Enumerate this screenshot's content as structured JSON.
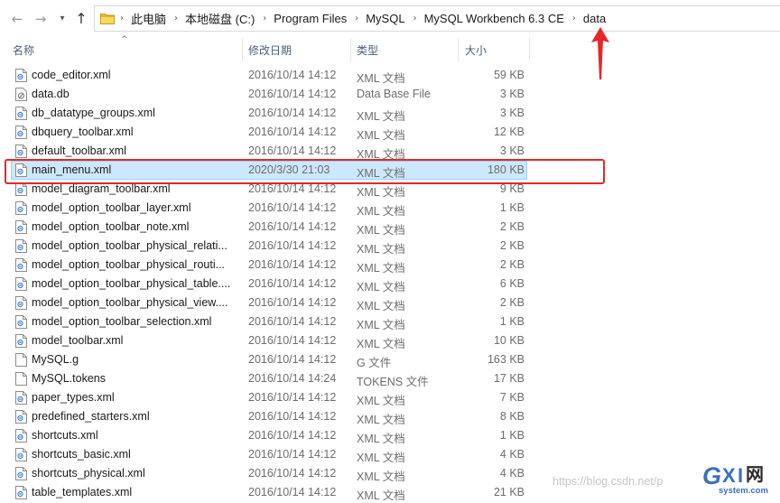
{
  "address_bar": {
    "crumbs": [
      "此电脑",
      "本地磁盘 (C:)",
      "Program Files",
      "MySQL",
      "MySQL Workbench 6.3 CE",
      "data"
    ]
  },
  "columns": {
    "name": "名称",
    "date": "修改日期",
    "type": "类型",
    "size": "大小"
  },
  "files": [
    {
      "name": "code_editor.xml",
      "date": "2016/10/14 14:12",
      "type": "XML 文档",
      "size": "59 KB",
      "icon": "xml"
    },
    {
      "name": "data.db",
      "date": "2016/10/14 14:12",
      "type": "Data Base File",
      "size": "3 KB",
      "icon": "db"
    },
    {
      "name": "db_datatype_groups.xml",
      "date": "2016/10/14 14:12",
      "type": "XML 文档",
      "size": "3 KB",
      "icon": "xml"
    },
    {
      "name": "dbquery_toolbar.xml",
      "date": "2016/10/14 14:12",
      "type": "XML 文档",
      "size": "12 KB",
      "icon": "xml"
    },
    {
      "name": "default_toolbar.xml",
      "date": "2016/10/14 14:12",
      "type": "XML 文档",
      "size": "3 KB",
      "icon": "xml"
    },
    {
      "name": "main_menu.xml",
      "date": "2020/3/30 21:03",
      "type": "XML 文档",
      "size": "180 KB",
      "icon": "xml",
      "selected": true
    },
    {
      "name": "model_diagram_toolbar.xml",
      "date": "2016/10/14 14:12",
      "type": "XML 文档",
      "size": "9 KB",
      "icon": "xml"
    },
    {
      "name": "model_option_toolbar_layer.xml",
      "date": "2016/10/14 14:12",
      "type": "XML 文档",
      "size": "1 KB",
      "icon": "xml"
    },
    {
      "name": "model_option_toolbar_note.xml",
      "date": "2016/10/14 14:12",
      "type": "XML 文档",
      "size": "2 KB",
      "icon": "xml"
    },
    {
      "name": "model_option_toolbar_physical_relati...",
      "date": "2016/10/14 14:12",
      "type": "XML 文档",
      "size": "2 KB",
      "icon": "xml"
    },
    {
      "name": "model_option_toolbar_physical_routi...",
      "date": "2016/10/14 14:12",
      "type": "XML 文档",
      "size": "2 KB",
      "icon": "xml"
    },
    {
      "name": "model_option_toolbar_physical_table....",
      "date": "2016/10/14 14:12",
      "type": "XML 文档",
      "size": "6 KB",
      "icon": "xml"
    },
    {
      "name": "model_option_toolbar_physical_view....",
      "date": "2016/10/14 14:12",
      "type": "XML 文档",
      "size": "2 KB",
      "icon": "xml"
    },
    {
      "name": "model_option_toolbar_selection.xml",
      "date": "2016/10/14 14:12",
      "type": "XML 文档",
      "size": "1 KB",
      "icon": "xml"
    },
    {
      "name": "model_toolbar.xml",
      "date": "2016/10/14 14:12",
      "type": "XML 文档",
      "size": "10 KB",
      "icon": "xml"
    },
    {
      "name": "MySQL.g",
      "date": "2016/10/14 14:12",
      "type": "G 文件",
      "size": "163 KB",
      "icon": "blank"
    },
    {
      "name": "MySQL.tokens",
      "date": "2016/10/14 14:24",
      "type": "TOKENS 文件",
      "size": "17 KB",
      "icon": "blank"
    },
    {
      "name": "paper_types.xml",
      "date": "2016/10/14 14:12",
      "type": "XML 文档",
      "size": "7 KB",
      "icon": "xml"
    },
    {
      "name": "predefined_starters.xml",
      "date": "2016/10/14 14:12",
      "type": "XML 文档",
      "size": "8 KB",
      "icon": "xml"
    },
    {
      "name": "shortcuts.xml",
      "date": "2016/10/14 14:12",
      "type": "XML 文档",
      "size": "1 KB",
      "icon": "xml"
    },
    {
      "name": "shortcuts_basic.xml",
      "date": "2016/10/14 14:12",
      "type": "XML 文档",
      "size": "4 KB",
      "icon": "xml"
    },
    {
      "name": "shortcuts_physical.xml",
      "date": "2016/10/14 14:12",
      "type": "XML 文档",
      "size": "4 KB",
      "icon": "xml"
    },
    {
      "name": "table_templates.xml",
      "date": "2016/10/14 14:12",
      "type": "XML 文档",
      "size": "21 KB",
      "icon": "xml"
    }
  ],
  "watermark": "https://blog.csdn.net/p",
  "logo": {
    "text": "GXI网",
    "domain": "system.com"
  },
  "colors": {
    "selection_bg": "#cce8ff",
    "selection_border": "#99d1ff",
    "annotation_red": "#e8262a",
    "header_text": "#4c607a"
  }
}
